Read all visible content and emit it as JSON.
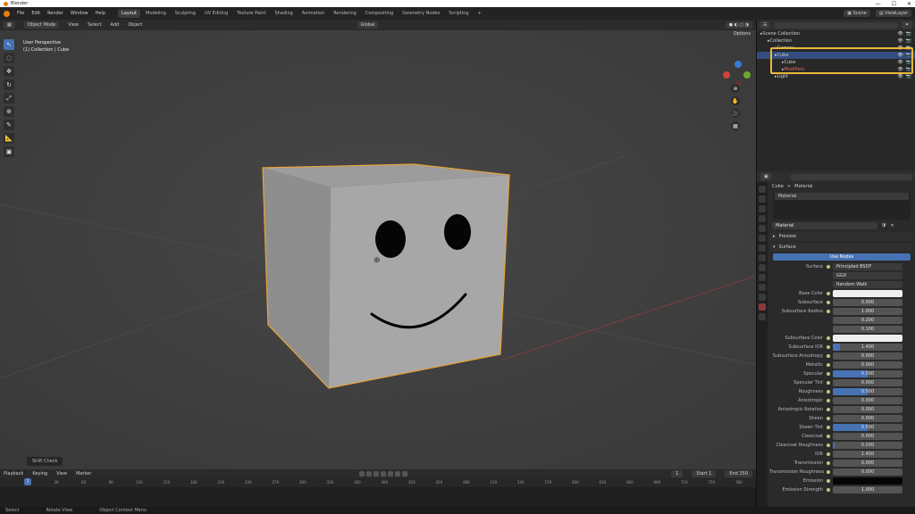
{
  "window": {
    "title": "Blender",
    "controls": [
      "—",
      "☐",
      "✕"
    ]
  },
  "menu": [
    "File",
    "Edit",
    "Render",
    "Window",
    "Help"
  ],
  "workspaces": [
    "Layout",
    "Modeling",
    "Sculpting",
    "UV Editing",
    "Texture Paint",
    "Shading",
    "Animation",
    "Rendering",
    "Compositing",
    "Geometry Nodes",
    "Scripting",
    "+"
  ],
  "active_workspace": "Layout",
  "scene": {
    "label": "Scene",
    "view_layer": "ViewLayer"
  },
  "viewport": {
    "mode": "Object Mode",
    "menus": [
      "View",
      "Select",
      "Add",
      "Object"
    ],
    "transform": "Global",
    "options_label": "Options",
    "overlay_title": "User Perspective",
    "overlay_subtitle": "(1) Collection | Cube",
    "status_chip": "Shift Check",
    "tools": [
      "↖",
      "◌",
      "✥",
      "↻",
      "⤢",
      "⊕",
      "✎",
      "📐",
      "▣"
    ],
    "nav": [
      "⊕",
      "✋",
      "🎥",
      "▦"
    ]
  },
  "timeline": {
    "menus": [
      "Playback",
      "Keying",
      "View",
      "Marker"
    ],
    "current_frame": "1",
    "start_label": "Start",
    "start_value": "1",
    "end_label": "End",
    "end_value": "250",
    "ticks": [
      "0",
      "30",
      "60",
      "90",
      "120",
      "150",
      "180",
      "210",
      "240",
      "270",
      "300",
      "330",
      "360",
      "390",
      "420",
      "450",
      "480",
      "510",
      "540",
      "570",
      "600",
      "630",
      "660",
      "690",
      "720",
      "750",
      "780"
    ]
  },
  "statusbar": [
    "Select",
    "Rotate View",
    "Object Context Menu"
  ],
  "outliner": {
    "rows": [
      {
        "label": "Scene Collection",
        "indent": 0,
        "selected": false
      },
      {
        "label": "Collection",
        "indent": 1,
        "selected": false
      },
      {
        "label": "Camera",
        "indent": 2,
        "selected": false
      },
      {
        "label": "Cube",
        "indent": 2,
        "selected": true
      },
      {
        "label": "Cube",
        "indent": 3,
        "selected": false
      },
      {
        "label": "Modifiers",
        "indent": 3,
        "selected": false
      },
      {
        "label": "Light",
        "indent": 2,
        "selected": false
      }
    ]
  },
  "properties": {
    "breadcrumb_object": "Cube",
    "breadcrumb_sep": ">",
    "breadcrumb_material": "Material",
    "slot_name": "Material",
    "material_name": "Material",
    "preview_label": "Preview",
    "surface_panel": "Surface",
    "use_nodes": "Use Nodes",
    "surface_label": "Surface",
    "surface_value": "Principled BSDF",
    "distribution": "GGX",
    "subsurface_method": "Random Walk",
    "rows": [
      {
        "label": "Base Color",
        "kind": "color",
        "value": ""
      },
      {
        "label": "Subsurface",
        "kind": "num",
        "value": "0.000",
        "fill": 0
      },
      {
        "label": "Subsurface Radius",
        "kind": "num",
        "value": "1.000",
        "fill": 0
      },
      {
        "label": "",
        "kind": "num",
        "value": "0.200",
        "fill": 0
      },
      {
        "label": "",
        "kind": "num",
        "value": "0.100",
        "fill": 0
      },
      {
        "label": "Subsurface Color",
        "kind": "color",
        "value": ""
      },
      {
        "label": "Subsurface IOR",
        "kind": "num",
        "value": "1.400",
        "fill": 0.1
      },
      {
        "label": "Subsurface Anisotropy",
        "kind": "num",
        "value": "0.000",
        "fill": 0
      },
      {
        "label": "Metallic",
        "kind": "num",
        "value": "0.000",
        "fill": 0
      },
      {
        "label": "Specular",
        "kind": "num",
        "value": "0.500",
        "fill": 0.5
      },
      {
        "label": "Specular Tint",
        "kind": "num",
        "value": "0.000",
        "fill": 0
      },
      {
        "label": "Roughness",
        "kind": "num",
        "value": "0.500",
        "fill": 0.5
      },
      {
        "label": "Anisotropic",
        "kind": "num",
        "value": "0.000",
        "fill": 0
      },
      {
        "label": "Anisotropic Rotation",
        "kind": "num",
        "value": "0.000",
        "fill": 0
      },
      {
        "label": "Sheen",
        "kind": "num",
        "value": "0.000",
        "fill": 0
      },
      {
        "label": "Sheen Tint",
        "kind": "num",
        "value": "0.500",
        "fill": 0.5
      },
      {
        "label": "Clearcoat",
        "kind": "num",
        "value": "0.000",
        "fill": 0
      },
      {
        "label": "Clearcoat Roughness",
        "kind": "num",
        "value": "0.030",
        "fill": 0.03
      },
      {
        "label": "IOR",
        "kind": "num",
        "value": "1.450",
        "fill": 0
      },
      {
        "label": "Transmission",
        "kind": "num",
        "value": "0.000",
        "fill": 0
      },
      {
        "label": "Transmission Roughness",
        "kind": "num",
        "value": "0.000",
        "fill": 0
      },
      {
        "label": "Emission",
        "kind": "black",
        "value": ""
      },
      {
        "label": "Emission Strength",
        "kind": "num",
        "value": "1.000",
        "fill": 0
      }
    ]
  },
  "colors": {
    "accent": "#4772b3",
    "selection_outline": "#e8a33a",
    "outliner_highlight": "#e8b83a",
    "cube_light": "#a6a6a6",
    "cube_dark": "#8d8d8d"
  }
}
